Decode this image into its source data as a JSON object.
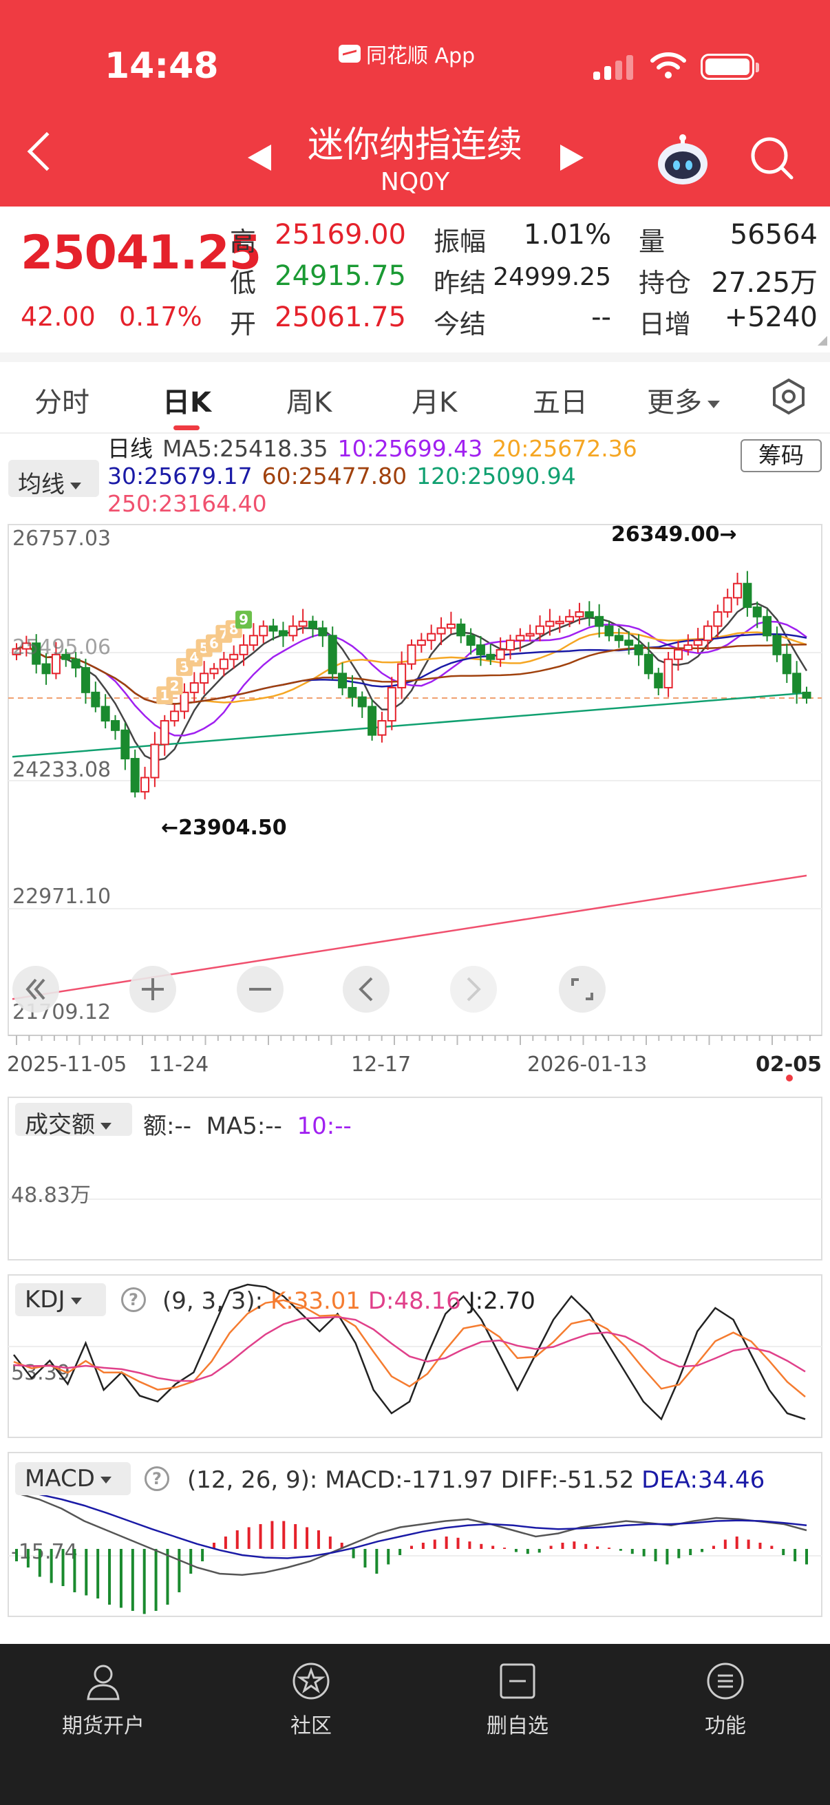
{
  "status_bar": {
    "time": "14:48",
    "app_name": "同花顺 App"
  },
  "header": {
    "title": "迷你纳指连续",
    "code": "NQ0Y"
  },
  "quote": {
    "last": "25041.25",
    "change": "42.00",
    "change_pct": "0.17%",
    "rows": [
      [
        {
          "label": "高",
          "value": "25169.00",
          "color": "red"
        },
        {
          "label": "振幅",
          "value": "1.01%",
          "color": "dark"
        },
        {
          "label": "量",
          "value": "56564",
          "color": "dark"
        }
      ],
      [
        {
          "label": "低",
          "value": "24915.75",
          "color": "green"
        },
        {
          "label": "昨结",
          "value": "24999.25",
          "color": "dark"
        },
        {
          "label": "持仓",
          "value": "27.25万",
          "color": "dark"
        }
      ],
      [
        {
          "label": "开",
          "value": "25061.75",
          "color": "red"
        },
        {
          "label": "今结",
          "value": "--",
          "color": "dark"
        },
        {
          "label": "日增",
          "value": "+5240",
          "color": "dark"
        }
      ]
    ]
  },
  "tabs": [
    "分时",
    "日K",
    "周K",
    "月K",
    "五日",
    "更多"
  ],
  "active_tab": "日K",
  "kline": {
    "ma_selector": "均线",
    "legend": {
      "period": "日线",
      "ma5": "MA5:25418.35",
      "ma10": "10:25699.43",
      "ma20": "20:25672.36",
      "ma30": "30:25679.17",
      "ma60": "60:25477.80",
      "ma120": "120:25090.94",
      "ma250": "250:23164.40"
    },
    "chip_button": "筹码",
    "y_labels": [
      "26757.03",
      "25495.06",
      "24233.08",
      "22971.10",
      "21709.12"
    ],
    "high_note": "26349.00→",
    "low_note": "←23904.50",
    "x_labels": [
      "2025-11-05",
      "11-24",
      "12-17",
      "2026-01-13",
      "02-05"
    ],
    "signal_marks": [
      "1",
      "2",
      "3",
      "4",
      "5",
      "6",
      "7",
      "8",
      "9"
    ]
  },
  "colors": {
    "up": "#e5212b",
    "down": "#1a8a2e",
    "ma5": "#444444",
    "ma10": "#a020f0",
    "ma20": "#f5a623",
    "ma30": "#1a1aa6",
    "ma60": "#a0410d",
    "ma120": "#10a070",
    "ma250": "#f0506e"
  },
  "volume": {
    "selector": "成交额",
    "legend_amount": "额:--",
    "legend_ma5": "MA5:--",
    "legend_ma10": "10:--",
    "y_label": "48.83万"
  },
  "kdj": {
    "selector": "KDJ",
    "params": "(9, 3, 3):",
    "k": "K:33.01",
    "d": "D:48.16",
    "j": "J:2.70",
    "y_label": "53.39"
  },
  "macd": {
    "selector": "MACD",
    "params": "(12, 26, 9):",
    "macd": "MACD:-171.97",
    "diff": "DIFF:-51.52",
    "dea": "DEA:34.46",
    "y_label": "-15.74"
  },
  "bottom_nav": [
    "期货开户",
    "社区",
    "删自选",
    "功能"
  ]
}
